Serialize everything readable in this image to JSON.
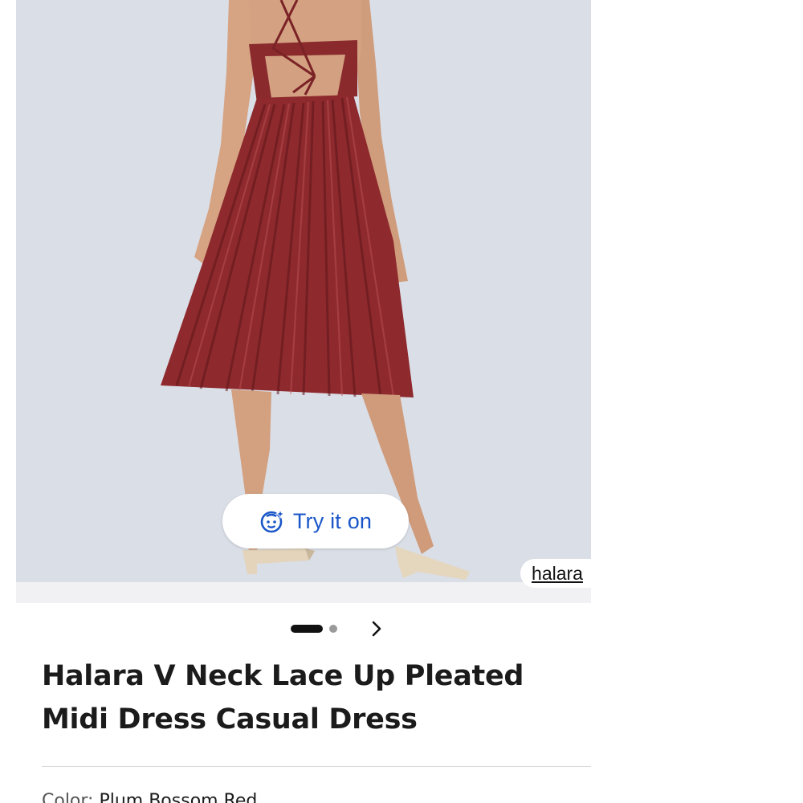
{
  "product_image": {
    "alt": "Back view of a model wearing a pleated satin midi dress",
    "dress_color": "#8e2a2e",
    "background_color": "#dadee6"
  },
  "try_on": {
    "label": "Try it on",
    "icon": "sparkle-face-icon",
    "color": "#1a56c8"
  },
  "source": {
    "label": "halara"
  },
  "carousel": {
    "total": 2,
    "active": 1,
    "next_icon": "chevron-right-icon"
  },
  "product": {
    "title": "Halara V Neck Lace Up Pleated Midi Dress Casual Dress",
    "color_label": "Color:",
    "color_value": "Plum Bossom Red"
  }
}
